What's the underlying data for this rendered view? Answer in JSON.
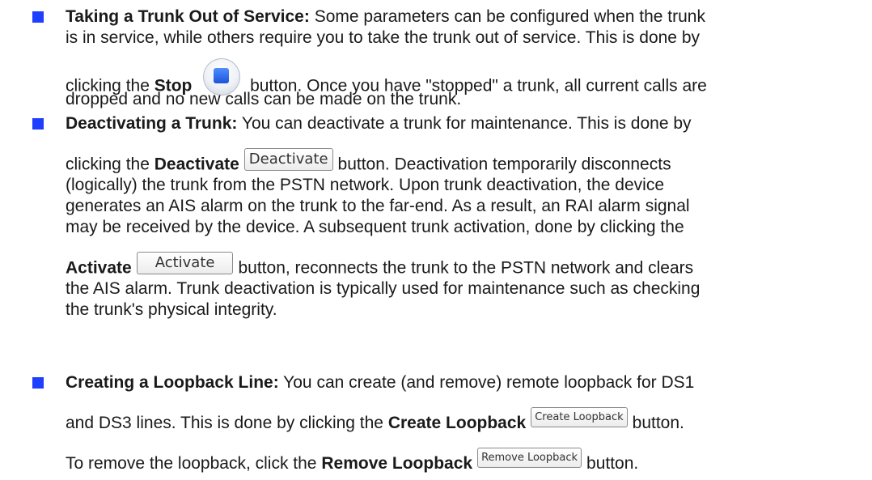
{
  "items": [
    {
      "title": "Taking a Trunk Out of Service:",
      "l1": "Some parameters can be configured when the trunk",
      "l2": "is in service, while others require you to take the trunk out of service. This is done by",
      "l3_pre": "clicking the",
      "l3_bold": "Stop",
      "l3_post": "button. Once you have \"stopped\" a trunk, all current calls are",
      "l4": "dropped and no new calls can be made on the trunk.",
      "stop_icon": "stop-icon"
    },
    {
      "title": "Deactivating a Trunk:",
      "l1": "You can deactivate a trunk for maintenance. This is done by",
      "l2_pre": "clicking the",
      "l2_bold": "Deactivate",
      "l2_btn": "Deactivate",
      "l2_post": "button. Deactivation temporarily disconnects",
      "l3": "(logically) the trunk from the PSTN network. Upon trunk deactivation, the device",
      "l4": "generates an AIS alarm on the trunk to the far-end. As a result, an RAI alarm signal",
      "l5": "may be received by the device. A subsequent trunk activation, done by clicking the",
      "l6_bold": "Activate",
      "l6_btn": "Activate",
      "l6_post": "button, reconnects the trunk to the PSTN network and clears",
      "l7": "the AIS alarm. Trunk deactivation is typically used for maintenance such as checking",
      "l8": "the trunk's physical integrity."
    },
    {
      "title": "Creating a Loopback Line:",
      "l1": "You can create (and remove) remote loopback for DS1",
      "l2_pre": "and DS3 lines. This is done by clicking the",
      "l2_bold": "Create Loopback",
      "l2_btn": "Create Loopback",
      "l2_post": "button.",
      "l3_pre": "To remove the loopback, click the",
      "l3_bold": "Remove Loopback",
      "l3_btn": "Remove Loopback",
      "l3_post": "button."
    }
  ],
  "colors": {
    "bullet": "#1f3fff",
    "text": "#1a1a1a"
  }
}
